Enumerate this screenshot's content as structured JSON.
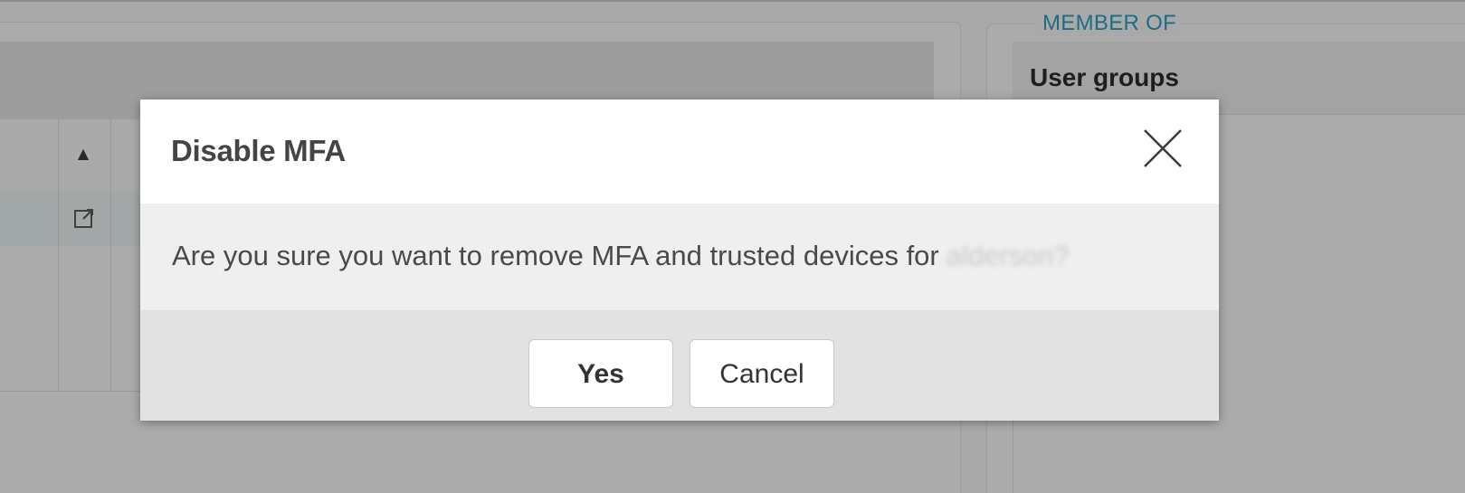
{
  "background": {
    "member_of_label": "MEMBER OF",
    "user_groups_label": "User groups",
    "sort_icon": "sort-ascending-icon",
    "open_icon": "external-link-icon"
  },
  "dialog": {
    "title": "Disable MFA",
    "message": "Are you sure you want to remove MFA and trusted devices for",
    "redacted_username": "alderson?",
    "buttons": {
      "yes": "Yes",
      "cancel": "Cancel"
    },
    "close_icon": "close-icon"
  },
  "colors": {
    "overlay": "#a9a9a9",
    "dialog_header": "#ffffff",
    "dialog_body": "#efefef",
    "dialog_footer": "#e2e2e2",
    "accent_text": "#1b6d85",
    "title_text": "#444444"
  }
}
